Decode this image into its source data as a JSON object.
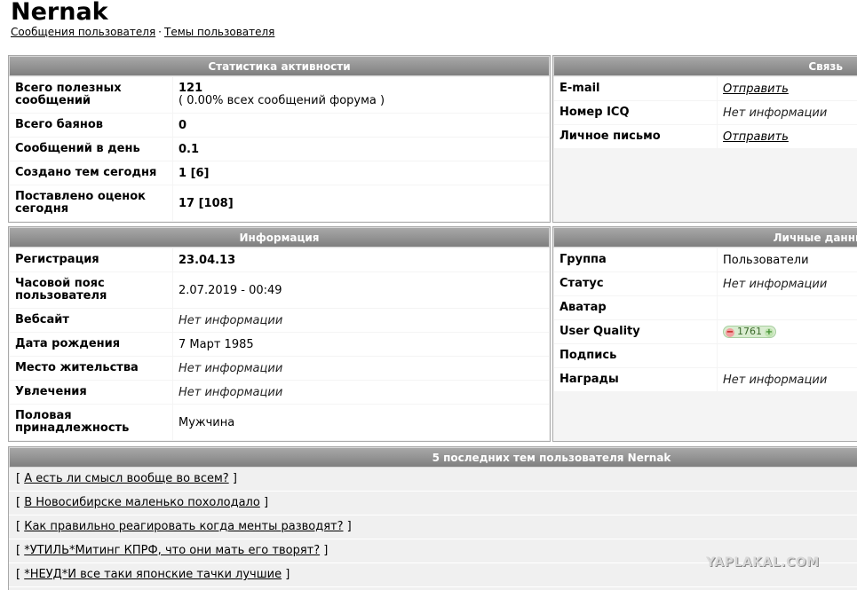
{
  "user": {
    "name": "Nernak"
  },
  "nav": {
    "posts_link": "Сообщения пользователя",
    "separator": "·",
    "topics_link": "Темы пользователя"
  },
  "activity": {
    "header": "Статистика активности",
    "rows": [
      {
        "label": "Всего полезных сообщений",
        "value": "121",
        "sub": "( 0.00% всех сообщений форума )"
      },
      {
        "label": "Всего баянов",
        "value": "0"
      },
      {
        "label": "Сообщений в день",
        "value": "0.1"
      },
      {
        "label": "Создано тем сегодня",
        "value": "1 [6]"
      },
      {
        "label": "Поставлено оценок сегодня",
        "value": "17 [108]"
      }
    ]
  },
  "contact": {
    "header": "Связь",
    "rows": [
      {
        "label": "E-mail",
        "value": "Отправить"
      },
      {
        "label": "Номер ICQ",
        "value": "Нет информации"
      },
      {
        "label": "Личное письмо",
        "value": "Отправить"
      }
    ]
  },
  "info": {
    "header": "Информация",
    "rows": [
      {
        "label": "Регистрация",
        "value": "23.04.13"
      },
      {
        "label": "Часовой пояс пользователя",
        "value": "2.07.2019 - 00:49"
      },
      {
        "label": "Вебсайт",
        "value": "Нет информации"
      },
      {
        "label": "Дата рождения",
        "value": "7 Март 1985"
      },
      {
        "label": "Место жительства",
        "value": "Нет информации"
      },
      {
        "label": "Увлечения",
        "value": "Нет информации"
      },
      {
        "label": "Половая принадлежность",
        "value": "Мужчина"
      }
    ]
  },
  "personal": {
    "header": "Личные данные",
    "rows": [
      {
        "label": "Группа",
        "value": "Пользователи"
      },
      {
        "label": "Статус",
        "value": "Нет информации"
      },
      {
        "label": "Аватар",
        "value": ""
      },
      {
        "label": "User Quality",
        "value": "1761"
      },
      {
        "label": "Подпись",
        "value": ""
      },
      {
        "label": "Награды",
        "value": "Нет информации"
      }
    ]
  },
  "topics": {
    "header": "5 последних тем пользователя Nernak",
    "open": "[",
    "close": "]",
    "items": [
      "А есть ли смысл вообще во всем?",
      "В Новосибирске маленько похолодало",
      "Как правильно реагировать когда менты разводят?",
      "*УТИЛЬ*Митинг КПРФ, что они мать его творят?",
      "*НЕУД*И все таки японские тачки лучшие"
    ]
  },
  "watermark": "YAPLAKAL.COM"
}
